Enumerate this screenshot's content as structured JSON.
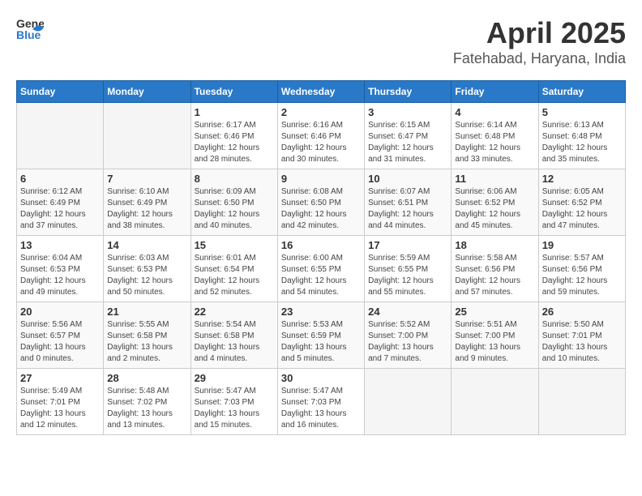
{
  "header": {
    "logo_general": "General",
    "logo_blue": "Blue",
    "month": "April 2025",
    "location": "Fatehabad, Haryana, India"
  },
  "weekdays": [
    "Sunday",
    "Monday",
    "Tuesday",
    "Wednesday",
    "Thursday",
    "Friday",
    "Saturday"
  ],
  "weeks": [
    [
      {
        "day": "",
        "info": ""
      },
      {
        "day": "",
        "info": ""
      },
      {
        "day": "1",
        "info": "Sunrise: 6:17 AM\nSunset: 6:46 PM\nDaylight: 12 hours\nand 28 minutes."
      },
      {
        "day": "2",
        "info": "Sunrise: 6:16 AM\nSunset: 6:46 PM\nDaylight: 12 hours\nand 30 minutes."
      },
      {
        "day": "3",
        "info": "Sunrise: 6:15 AM\nSunset: 6:47 PM\nDaylight: 12 hours\nand 31 minutes."
      },
      {
        "day": "4",
        "info": "Sunrise: 6:14 AM\nSunset: 6:48 PM\nDaylight: 12 hours\nand 33 minutes."
      },
      {
        "day": "5",
        "info": "Sunrise: 6:13 AM\nSunset: 6:48 PM\nDaylight: 12 hours\nand 35 minutes."
      }
    ],
    [
      {
        "day": "6",
        "info": "Sunrise: 6:12 AM\nSunset: 6:49 PM\nDaylight: 12 hours\nand 37 minutes."
      },
      {
        "day": "7",
        "info": "Sunrise: 6:10 AM\nSunset: 6:49 PM\nDaylight: 12 hours\nand 38 minutes."
      },
      {
        "day": "8",
        "info": "Sunrise: 6:09 AM\nSunset: 6:50 PM\nDaylight: 12 hours\nand 40 minutes."
      },
      {
        "day": "9",
        "info": "Sunrise: 6:08 AM\nSunset: 6:50 PM\nDaylight: 12 hours\nand 42 minutes."
      },
      {
        "day": "10",
        "info": "Sunrise: 6:07 AM\nSunset: 6:51 PM\nDaylight: 12 hours\nand 44 minutes."
      },
      {
        "day": "11",
        "info": "Sunrise: 6:06 AM\nSunset: 6:52 PM\nDaylight: 12 hours\nand 45 minutes."
      },
      {
        "day": "12",
        "info": "Sunrise: 6:05 AM\nSunset: 6:52 PM\nDaylight: 12 hours\nand 47 minutes."
      }
    ],
    [
      {
        "day": "13",
        "info": "Sunrise: 6:04 AM\nSunset: 6:53 PM\nDaylight: 12 hours\nand 49 minutes."
      },
      {
        "day": "14",
        "info": "Sunrise: 6:03 AM\nSunset: 6:53 PM\nDaylight: 12 hours\nand 50 minutes."
      },
      {
        "day": "15",
        "info": "Sunrise: 6:01 AM\nSunset: 6:54 PM\nDaylight: 12 hours\nand 52 minutes."
      },
      {
        "day": "16",
        "info": "Sunrise: 6:00 AM\nSunset: 6:55 PM\nDaylight: 12 hours\nand 54 minutes."
      },
      {
        "day": "17",
        "info": "Sunrise: 5:59 AM\nSunset: 6:55 PM\nDaylight: 12 hours\nand 55 minutes."
      },
      {
        "day": "18",
        "info": "Sunrise: 5:58 AM\nSunset: 6:56 PM\nDaylight: 12 hours\nand 57 minutes."
      },
      {
        "day": "19",
        "info": "Sunrise: 5:57 AM\nSunset: 6:56 PM\nDaylight: 12 hours\nand 59 minutes."
      }
    ],
    [
      {
        "day": "20",
        "info": "Sunrise: 5:56 AM\nSunset: 6:57 PM\nDaylight: 13 hours\nand 0 minutes."
      },
      {
        "day": "21",
        "info": "Sunrise: 5:55 AM\nSunset: 6:58 PM\nDaylight: 13 hours\nand 2 minutes."
      },
      {
        "day": "22",
        "info": "Sunrise: 5:54 AM\nSunset: 6:58 PM\nDaylight: 13 hours\nand 4 minutes."
      },
      {
        "day": "23",
        "info": "Sunrise: 5:53 AM\nSunset: 6:59 PM\nDaylight: 13 hours\nand 5 minutes."
      },
      {
        "day": "24",
        "info": "Sunrise: 5:52 AM\nSunset: 7:00 PM\nDaylight: 13 hours\nand 7 minutes."
      },
      {
        "day": "25",
        "info": "Sunrise: 5:51 AM\nSunset: 7:00 PM\nDaylight: 13 hours\nand 9 minutes."
      },
      {
        "day": "26",
        "info": "Sunrise: 5:50 AM\nSunset: 7:01 PM\nDaylight: 13 hours\nand 10 minutes."
      }
    ],
    [
      {
        "day": "27",
        "info": "Sunrise: 5:49 AM\nSunset: 7:01 PM\nDaylight: 13 hours\nand 12 minutes."
      },
      {
        "day": "28",
        "info": "Sunrise: 5:48 AM\nSunset: 7:02 PM\nDaylight: 13 hours\nand 13 minutes."
      },
      {
        "day": "29",
        "info": "Sunrise: 5:47 AM\nSunset: 7:03 PM\nDaylight: 13 hours\nand 15 minutes."
      },
      {
        "day": "30",
        "info": "Sunrise: 5:47 AM\nSunset: 7:03 PM\nDaylight: 13 hours\nand 16 minutes."
      },
      {
        "day": "",
        "info": ""
      },
      {
        "day": "",
        "info": ""
      },
      {
        "day": "",
        "info": ""
      }
    ]
  ]
}
